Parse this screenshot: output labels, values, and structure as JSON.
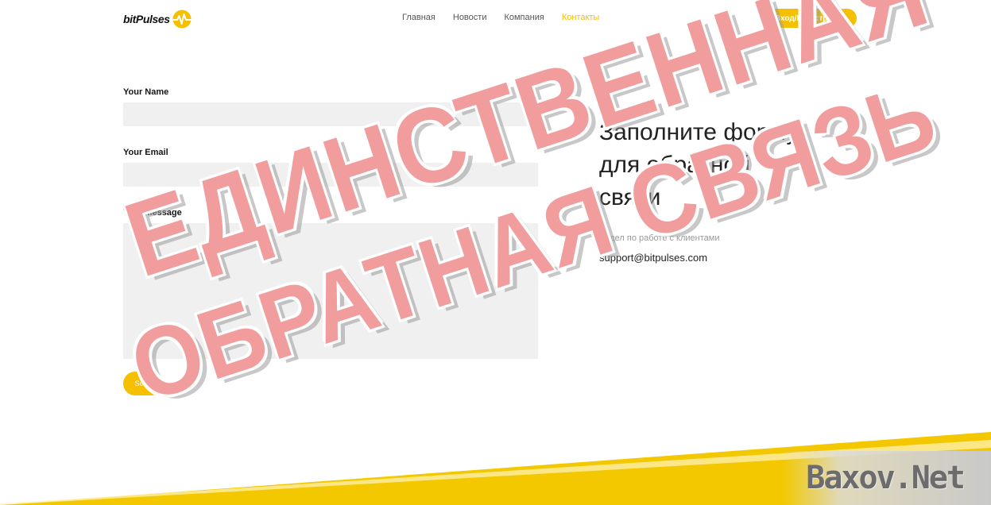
{
  "brand": {
    "logo_text": "bitPulses",
    "accent_color": "#f4c000"
  },
  "nav": {
    "items": [
      {
        "label": "Главная"
      },
      {
        "label": "Новости"
      },
      {
        "label": "Компания"
      },
      {
        "label": "Контакты"
      }
    ],
    "active_index": 3
  },
  "header": {
    "login_label": "Вход/Регистрация"
  },
  "form": {
    "name_label": "Your Name",
    "name_value": "",
    "email_label": "Your Email",
    "email_value": "",
    "message_label": "Your Message",
    "message_value": "",
    "send_label": "Send"
  },
  "contact": {
    "title_line1": "Заполните форму",
    "title_line2": "для обратной",
    "title_line3": "связи",
    "department": "Отдел по работе с клиентами",
    "email": "support@bitpulses.com"
  },
  "overlay": {
    "stamp_line1": "ЕДИНСТВЕННАЯ",
    "stamp_line2": "ОБРАТНАЯ СВЯЗЬ",
    "watermark": "Baxov.Net"
  }
}
